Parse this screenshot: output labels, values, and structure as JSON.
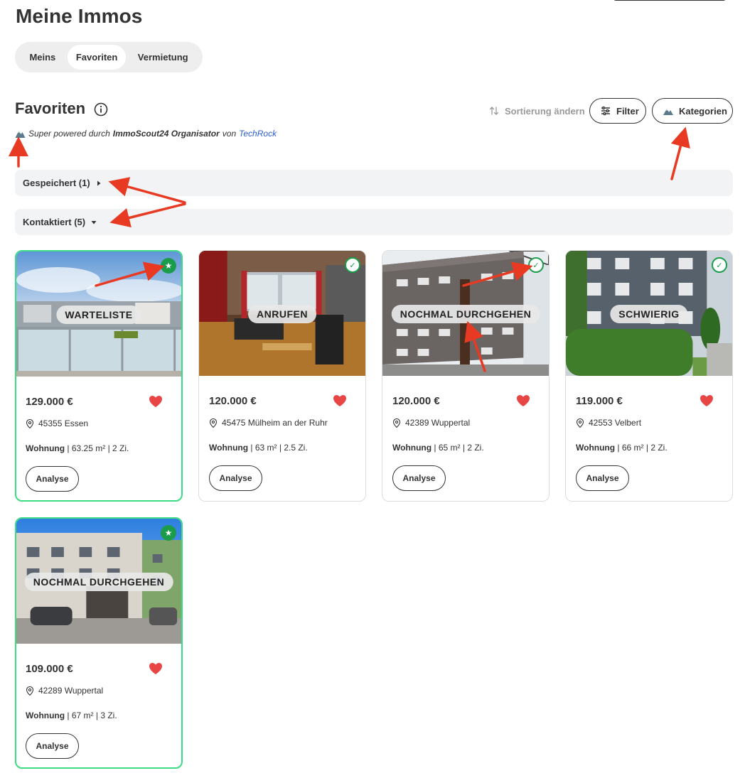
{
  "page": {
    "title": "Meine Immos"
  },
  "tabs": [
    {
      "label": "Meins",
      "active": false
    },
    {
      "label": "Favoriten",
      "active": true
    },
    {
      "label": "Vermietung",
      "active": false
    }
  ],
  "section": {
    "title": "Favoriten",
    "sort_label": "Sortierung ändern",
    "filter_label": "Filter",
    "categories_label": "Kategorien"
  },
  "powered": {
    "prefix": "Super powered durch",
    "organizer": "ImmoScout24 Organisator",
    "by": "von",
    "company": "TechRock"
  },
  "groups": [
    {
      "label": "Gespeichert (1)",
      "expanded": false
    },
    {
      "label": "Kontaktiert (5)",
      "expanded": true
    }
  ],
  "listings": [
    {
      "category": "WARTELISTE",
      "badge": "star",
      "price": "129.000 €",
      "location": "45355 Essen",
      "type": "Wohnung",
      "details": " | 63.25 m² | 2 Zi.",
      "button": "Analyse"
    },
    {
      "category": "ANRUFEN",
      "badge": "check",
      "price": "120.000 €",
      "location": "45475 Mülheim an der Ruhr",
      "type": "Wohnung",
      "details": " | 63 m² | 2.5 Zi.",
      "button": "Analyse"
    },
    {
      "category": "NOCHMAL DURCHGEHEN",
      "badge": "check",
      "price": "120.000 €",
      "location": "42389 Wuppertal",
      "type": "Wohnung",
      "details": " | 65 m² | 2 Zi.",
      "button": "Analyse"
    },
    {
      "category": "SCHWIERIG",
      "badge": "check",
      "price": "119.000 €",
      "location": "42553 Velbert",
      "type": "Wohnung",
      "details": " | 66 m² | 2 Zi.",
      "button": "Analyse"
    },
    {
      "category": "NOCHMAL DURCHGEHEN",
      "badge": "star",
      "price": "109.000 €",
      "location": "42289 Wuppertal",
      "type": "Wohnung",
      "details": " | 67 m² | 3 Zi.",
      "button": "Analyse"
    }
  ],
  "icons": {
    "info": "info-icon",
    "sort": "sort-arrows-icon",
    "filter": "sliders-icon",
    "categories": "mountain-icon",
    "location": "location-pin-icon",
    "favorite": "heart-icon",
    "star_badge": "star-icon",
    "check_badge": "check-icon"
  },
  "colors": {
    "highlight_border": "#3ddc84",
    "badge_green": "#1a9c4a",
    "heart": "#e84545",
    "link": "#2a5bd7",
    "annotation_arrow": "#e83a22"
  }
}
